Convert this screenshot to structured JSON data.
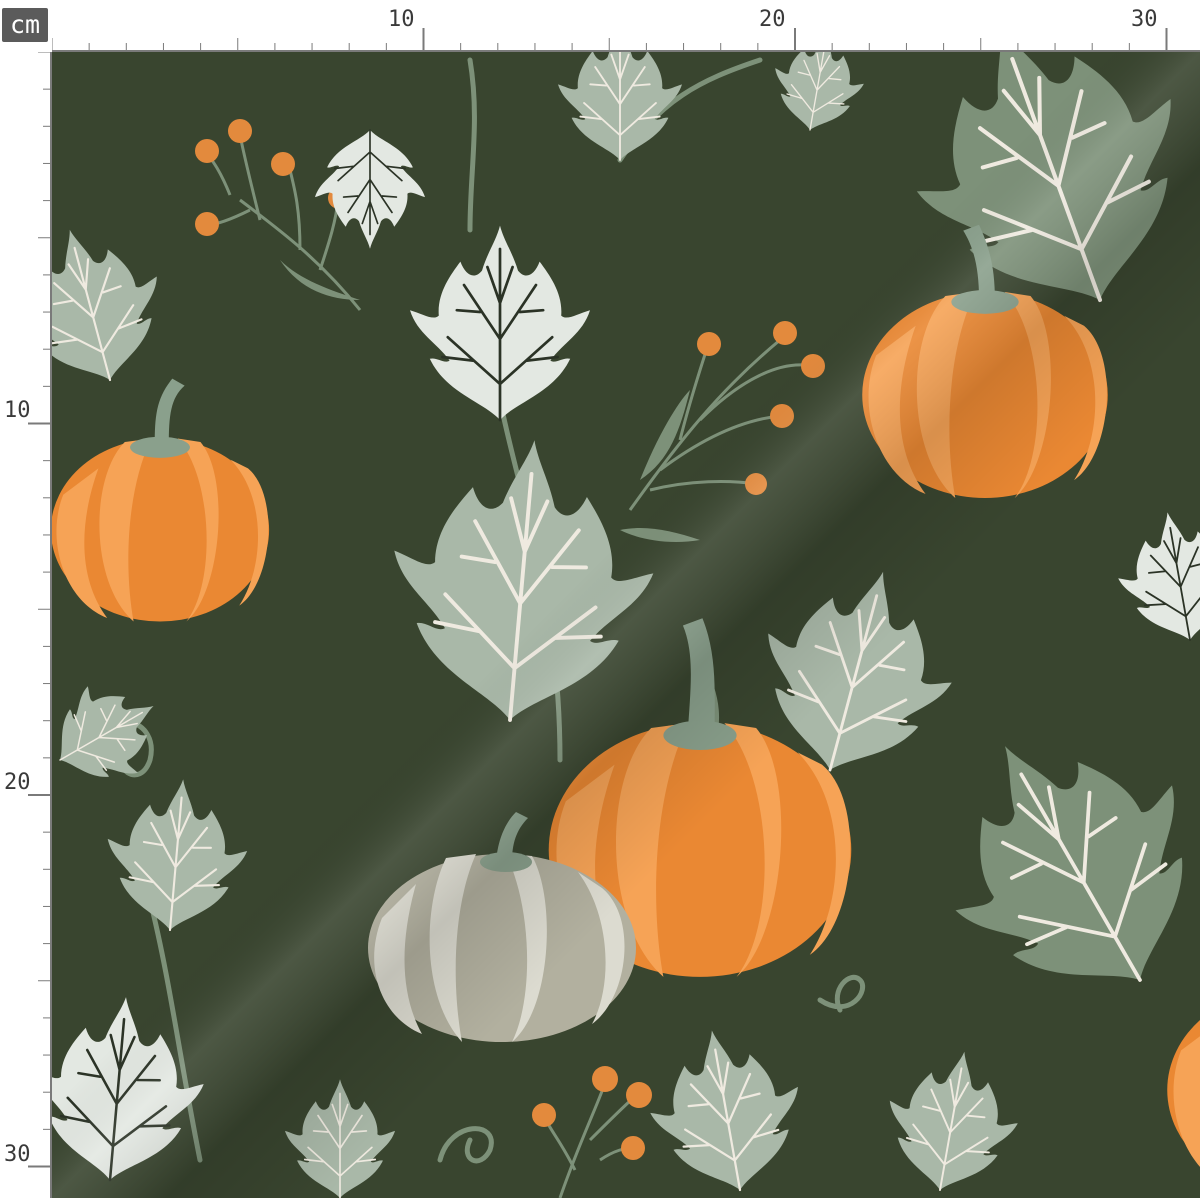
{
  "ruler": {
    "unit": "cm",
    "top_labels": [
      "10",
      "20",
      "30"
    ],
    "left_labels": [
      "10",
      "20",
      "30"
    ]
  },
  "colors": {
    "background": "#39452f",
    "pumpkin_light": "#f6a356",
    "pumpkin_dark": "#ea8833",
    "white_pumpkin_light": "#dcdbd0",
    "white_pumpkin_dark": "#b2b09f",
    "stem": "#8aa08c",
    "leaf_sage": "#a9b8a8",
    "leaf_green": "#7d9179",
    "leaf_white": "#e3e8e2",
    "vein": "#efeae0",
    "berry": "#e38a3d"
  },
  "pattern": {
    "name": "pumpkin-leaf-pattern"
  }
}
